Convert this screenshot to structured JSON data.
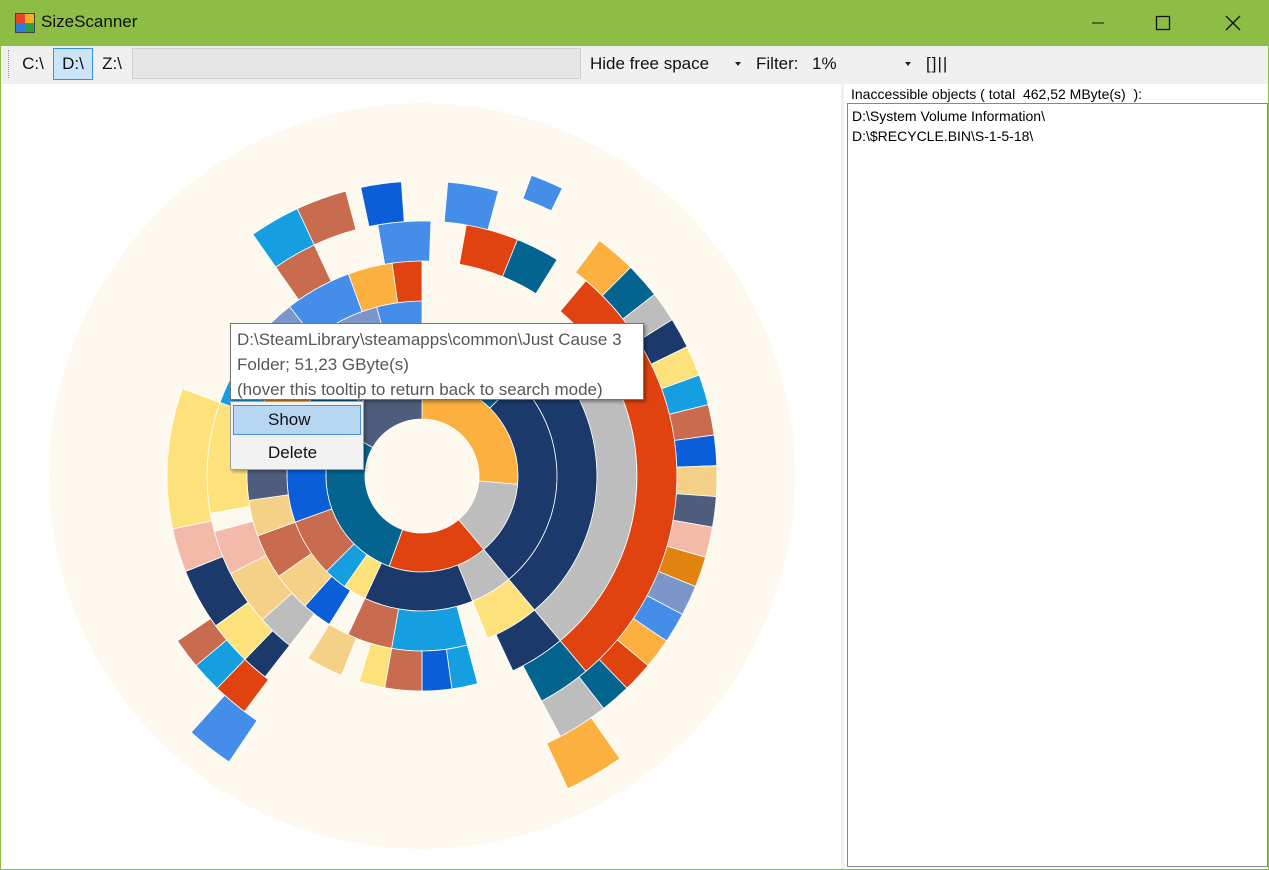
{
  "window": {
    "title": "SizeScanner",
    "titlebar_color": "#8dbd45"
  },
  "toolbar": {
    "drives": [
      {
        "label": "C:\\",
        "active": false
      },
      {
        "label": "D:\\",
        "active": true
      },
      {
        "label": "Z:\\",
        "active": false
      }
    ],
    "path_value": "",
    "free_space_mode": "Hide free space",
    "filter_label": "Filter:",
    "filter_value": "1%",
    "toggle_label": "[]||"
  },
  "inaccessible": {
    "header": "Inaccessible objects ( total  462,52 MByte(s)  ):",
    "items": [
      "D:\\System Volume Information\\",
      "D:\\$RECYCLE.BIN\\S-1-5-18\\"
    ]
  },
  "tooltip": {
    "path": "D:\\SteamLibrary\\steamapps\\common\\Just Cause 3",
    "info": "Folder; 51,23 GByte(s)",
    "hint": "(hover this tooltip to return back to search mode)"
  },
  "context_menu": {
    "items": [
      "Show",
      "Delete"
    ],
    "highlighted": "Show"
  },
  "colors": {
    "free_space": "#fdf9ee",
    "orange": "#fbb040",
    "dark_orange": "#e2830f",
    "red_orange": "#e0430f",
    "navy": "#1b3a6b",
    "teal": "#046490",
    "blue": "#448de8",
    "royal_blue": "#0a5fd8",
    "sky": "#159fe0",
    "gray": "#bdbdbd",
    "slate": "#4e5d7d",
    "brick": "#c96b4e",
    "yellow": "#fde27c",
    "sand": "#f4d186",
    "pink": "#f3b9a9",
    "steel": "#7b96c8"
  }
}
